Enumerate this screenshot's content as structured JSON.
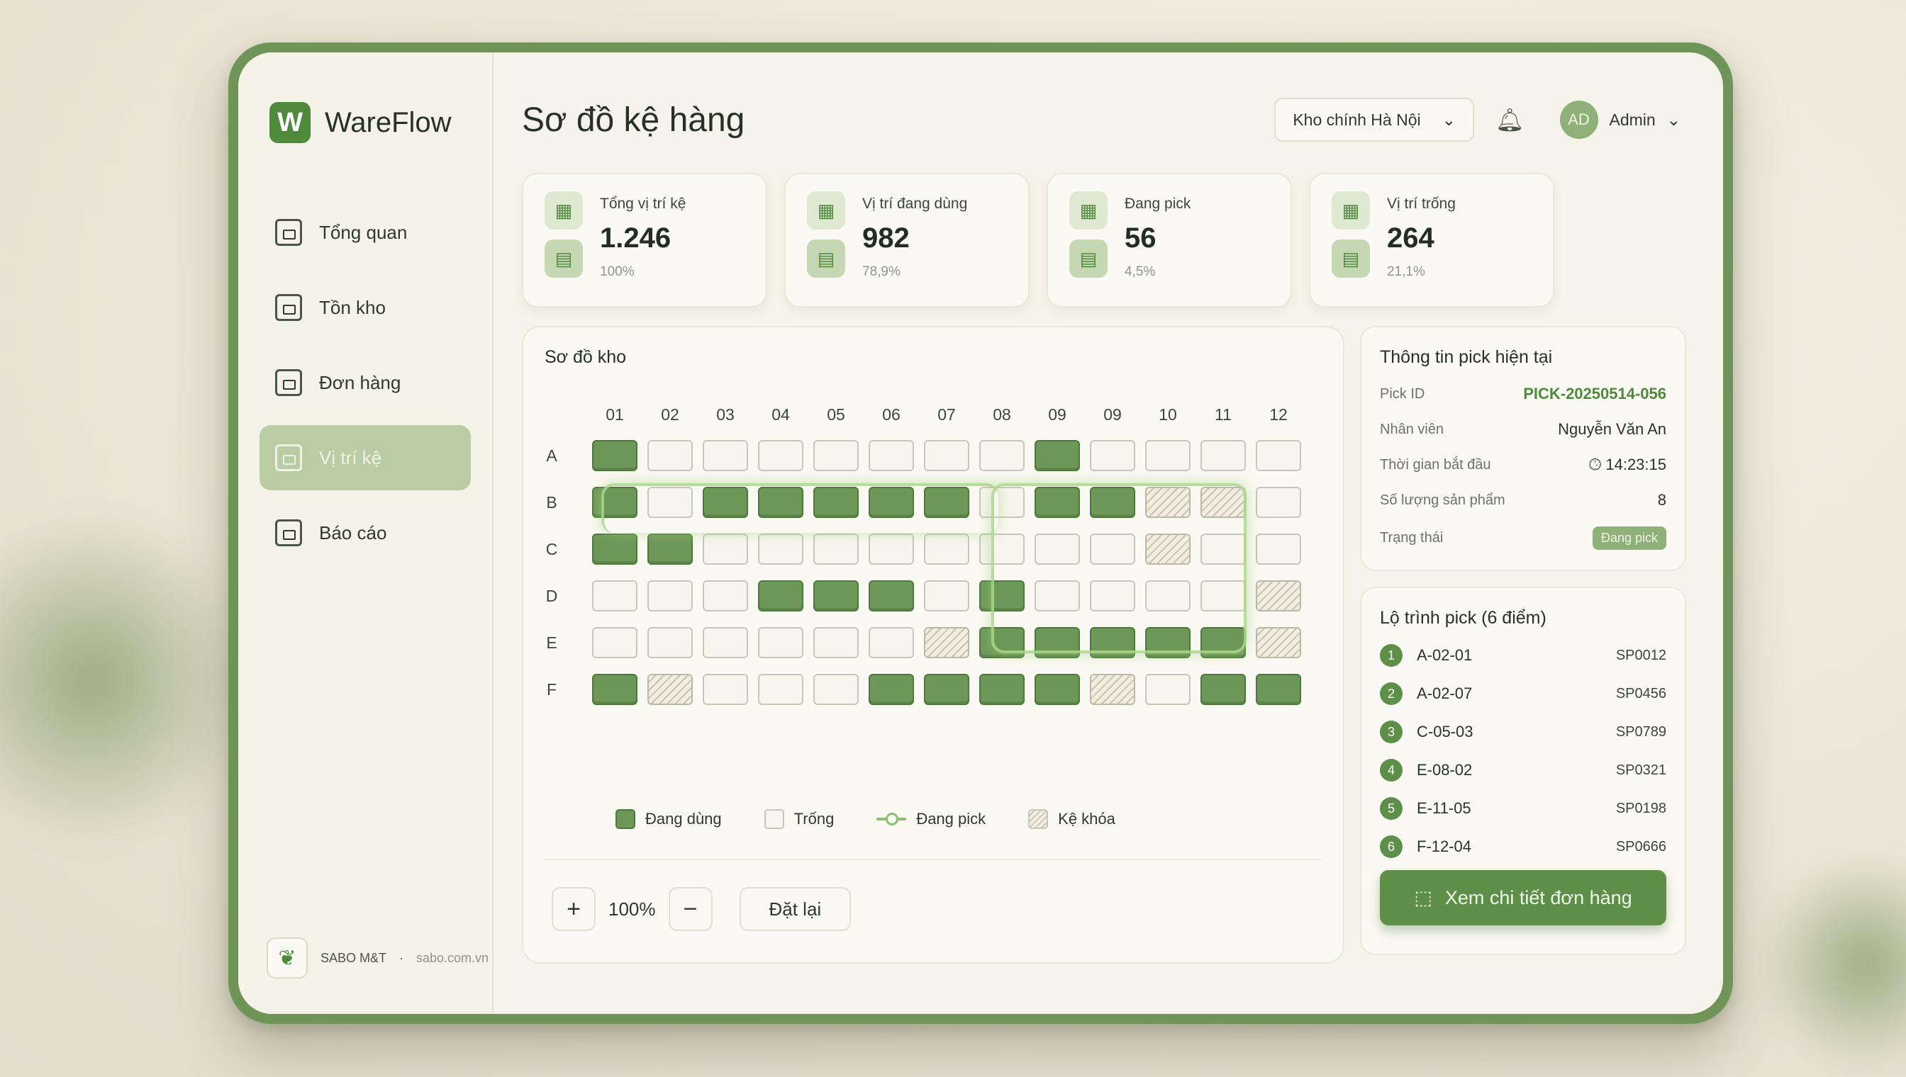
{
  "brand": {
    "name": "WareFlow",
    "logo_letter": "W"
  },
  "sidebar": {
    "items": [
      {
        "label": "Tổng quan",
        "icon": "home-icon",
        "active": false
      },
      {
        "label": "Tồn kho",
        "icon": "inventory-icon",
        "active": false
      },
      {
        "label": "Đơn hàng",
        "icon": "orders-icon",
        "active": false
      },
      {
        "label": "Vị trí kệ",
        "icon": "shelf-location-icon",
        "active": true
      },
      {
        "label": "Báo cáo",
        "icon": "report-icon",
        "active": false
      }
    ],
    "footer": {
      "company": "SABO M&T",
      "separator": "·",
      "domain": "sabo.com.vn"
    }
  },
  "header": {
    "title": "Sơ đồ kệ hàng",
    "warehouse": "Kho chính Hà Nội",
    "user_initials": "AD",
    "user_name": "Admin"
  },
  "stats": [
    {
      "label": "Tổng vị trí kệ",
      "value": "1.246",
      "pct": "100%"
    },
    {
      "label": "Vị trí đang dùng",
      "value": "982",
      "pct": "78,9%"
    },
    {
      "label": "Đang pick",
      "value": "56",
      "pct": "4,5%"
    },
    {
      "label": "Vị trí trống",
      "value": "264",
      "pct": "21,1%"
    }
  ],
  "map": {
    "title": "Sơ đồ kho",
    "columns": [
      "01",
      "02",
      "03",
      "04",
      "05",
      "06",
      "07",
      "08",
      "09",
      "09",
      "10",
      "11",
      "12"
    ],
    "rows": [
      "A",
      "B",
      "C",
      "D",
      "E",
      "F"
    ],
    "cells": [
      [
        "used",
        "empty",
        "empty",
        "empty",
        "empty",
        "empty",
        "empty",
        "empty",
        "used",
        "empty",
        "empty",
        "empty",
        "empty"
      ],
      [
        "used",
        "empty",
        "used",
        "used",
        "used",
        "used",
        "used",
        "empty",
        "used",
        "used",
        "locked",
        "locked",
        "empty"
      ],
      [
        "used",
        "used",
        "empty",
        "empty",
        "empty",
        "empty",
        "empty",
        "empty",
        "empty",
        "empty",
        "locked",
        "empty",
        "empty"
      ],
      [
        "empty",
        "empty",
        "empty",
        "used",
        "used",
        "used",
        "empty",
        "used",
        "empty",
        "empty",
        "empty",
        "empty",
        "locked"
      ],
      [
        "empty",
        "empty",
        "empty",
        "empty",
        "empty",
        "empty",
        "locked",
        "used",
        "used",
        "used",
        "used",
        "used",
        "locked"
      ],
      [
        "used",
        "locked",
        "empty",
        "empty",
        "empty",
        "used",
        "used",
        "used",
        "used",
        "locked",
        "empty",
        "used",
        "used"
      ]
    ],
    "legend": {
      "used": "Đang dùng",
      "empty": "Trống",
      "picking": "Đang pick",
      "locked": "Kệ khóa"
    },
    "zoom": "100%",
    "zoom_in": "+",
    "zoom_out": "−",
    "reset": "Đặt lại"
  },
  "pick_info": {
    "title": "Thông tin pick hiện tại",
    "rows": [
      {
        "label": "Pick ID",
        "value": "PICK-20250514-056"
      },
      {
        "label": "Nhân viên",
        "value": "Nguyễn Văn An"
      },
      {
        "label": "Thời gian bắt đầu",
        "value": "14:23:15"
      },
      {
        "label": "Số lượng sản phẩm",
        "value": "8"
      },
      {
        "label": "Trạng thái",
        "value": "Đang pick"
      }
    ]
  },
  "route": {
    "title": "Lộ trình pick (6 điểm)",
    "items": [
      {
        "num": "1",
        "loc": "A-02-01",
        "sku": "SP0012"
      },
      {
        "num": "2",
        "loc": "A-02-07",
        "sku": "SP0456"
      },
      {
        "num": "3",
        "loc": "C-05-03",
        "sku": "SP0789"
      },
      {
        "num": "4",
        "loc": "E-08-02",
        "sku": "SP0321"
      },
      {
        "num": "5",
        "loc": "E-11-05",
        "sku": "SP0198"
      },
      {
        "num": "6",
        "loc": "F-12-04",
        "sku": "SP0666"
      }
    ],
    "button": "Xem chi tiết đơn hàng"
  },
  "colors": {
    "accent": "#5e8f49",
    "used": "#6e9858",
    "active_nav": "#b9cca3"
  }
}
